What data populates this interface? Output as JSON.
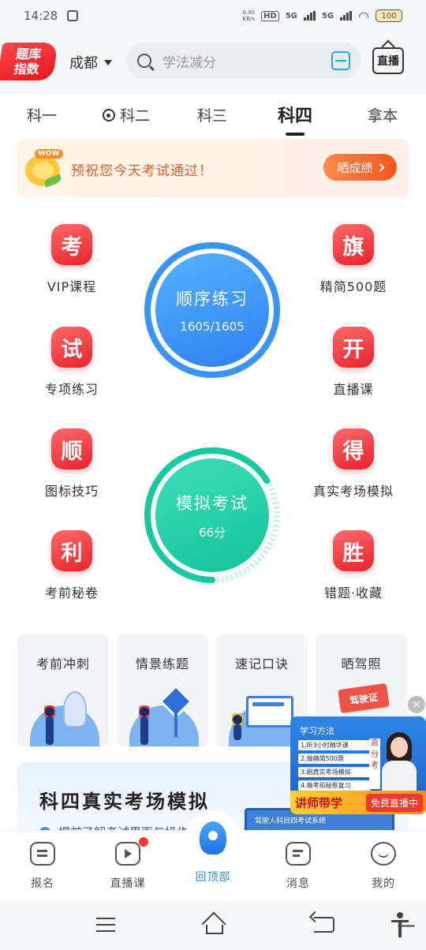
{
  "status_bar": {
    "time": "14:28",
    "net_speed": "0.00",
    "net_unit": "KB/s",
    "hd": "HD",
    "sim1": "5G",
    "sim2": "5G",
    "battery": "100"
  },
  "header": {
    "logo_line1": "题库",
    "logo_line2": "指数",
    "city": "成都",
    "search_placeholder": "学法减分",
    "live_label": "直播"
  },
  "tabs": [
    {
      "label": "科一"
    },
    {
      "label": "科二"
    },
    {
      "label": "科三"
    },
    {
      "label": "科四",
      "active": true
    },
    {
      "label": "拿本"
    }
  ],
  "banner": {
    "sticker": "WOW",
    "text": "预祝您今天考试通过！",
    "button": "晒成绩"
  },
  "features": [
    {
      "glyph": "考",
      "label": "VIP课程"
    },
    {
      "glyph": "旗",
      "label": "精简500题"
    },
    {
      "glyph": "试",
      "label": "专项练习"
    },
    {
      "glyph": "开",
      "label": "直播课"
    },
    {
      "glyph": "顺",
      "label": "图标技巧"
    },
    {
      "glyph": "得",
      "label": "真实考场模拟"
    },
    {
      "glyph": "利",
      "label": "考前秘卷"
    },
    {
      "glyph": "胜",
      "label": "错题·收藏",
      "notify": "!"
    }
  ],
  "practice": {
    "title": "顺序练习",
    "progress": "1605/1605",
    "fraction": 1.0,
    "color_start": "#55b4ff",
    "color_end": "#2f7ff0"
  },
  "exam": {
    "title": "模拟考试",
    "score": "66分",
    "fraction": 0.66,
    "color_start": "#3ee0b6",
    "color_end": "#14c29a"
  },
  "cards": [
    {
      "title": "考前冲刺"
    },
    {
      "title": "情景练题"
    },
    {
      "title": "速记口诀"
    },
    {
      "title": "晒驾照",
      "sticker": "驾驶证"
    }
  ],
  "lower_section": {
    "title": "科四真实考场模拟",
    "subtitle": "提前了解考试界面与操作",
    "screen_text": "驾驶人科目四考试系统"
  },
  "ad": {
    "heading": "学习方法",
    "lines": [
      "1.听3小时精华课",
      "2.做精简500题",
      "3.刷真实考场模拟",
      "4.做考前秘卷复习"
    ],
    "board_text": "高分考",
    "left_tag": "讲师带学",
    "right_tag": "免费直播中",
    "close": "×"
  },
  "bottom_nav": [
    {
      "label": "报名"
    },
    {
      "label": "直播课",
      "dot": true
    },
    {
      "label": "回顶部",
      "active": true
    },
    {
      "label": "消息"
    },
    {
      "label": "我的"
    }
  ],
  "colors": {
    "accent_blue": "#2a8be8",
    "accent_red": "#e8222a",
    "accent_green": "#14c29a",
    "banner_orange": "#f5561d"
  }
}
